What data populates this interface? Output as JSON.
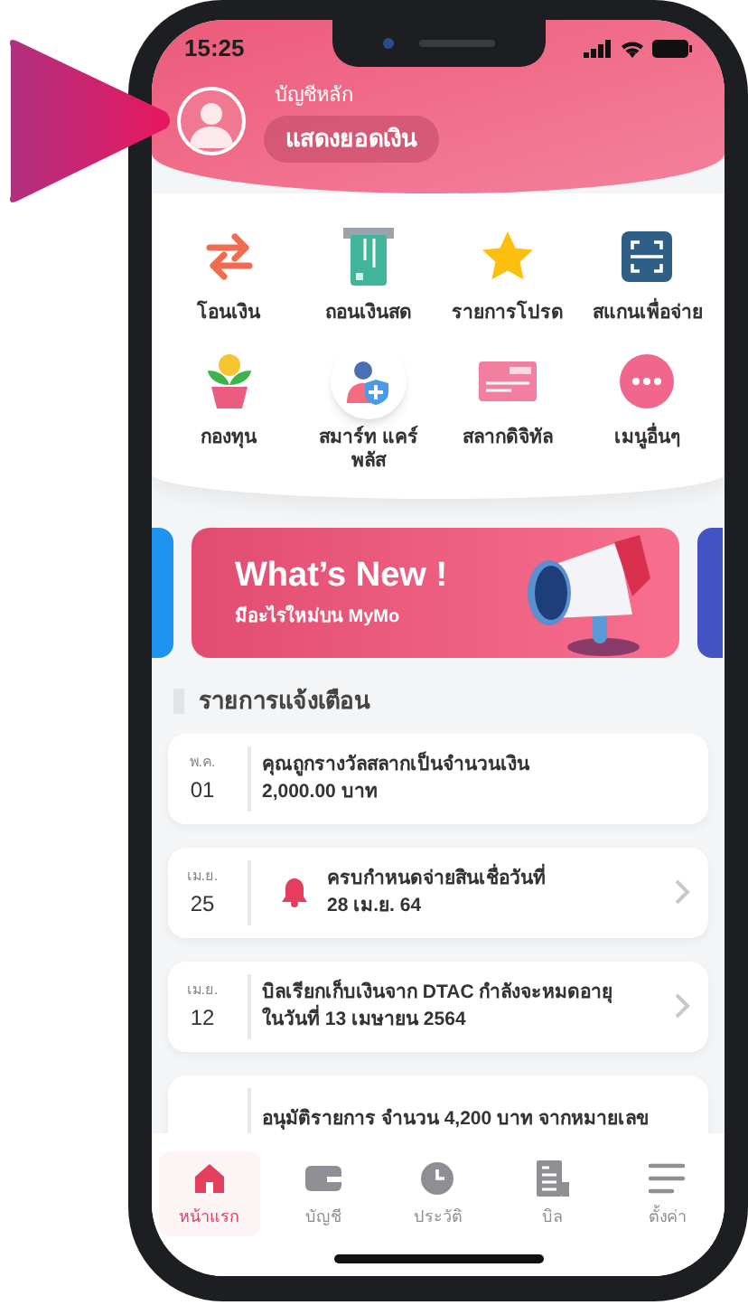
{
  "status_bar": {
    "time": "15:25"
  },
  "header": {
    "account_label": "บัญชีหลัก",
    "balance_button": "แสดงยอดเงิน"
  },
  "menu": [
    {
      "kind": "transfer",
      "label": "โอนเงิน"
    },
    {
      "kind": "atm",
      "label": "ถอนเงินสด"
    },
    {
      "kind": "star",
      "label": "รายการโปรด"
    },
    {
      "kind": "scan",
      "label": "สแกนเพื่อจ่าย"
    },
    {
      "kind": "fund",
      "label": "กองทุน"
    },
    {
      "kind": "insurance",
      "label": "สมาร์ท แคร์ พลัส"
    },
    {
      "kind": "lottery",
      "label": "สลากดิจิทัล"
    },
    {
      "kind": "more",
      "label": "เมนูอื่นๆ"
    }
  ],
  "banner": {
    "title": "What’s New !",
    "subtitle": "มีอะไรใหม่บน MyMo"
  },
  "notifications_title": "รายการแจ้งเตือน",
  "notifications": [
    {
      "month": "พ.ค.",
      "day": "01",
      "lines": [
        "คุณถูกรางวัลสลากเป็นจำนวนเงิน",
        "2,000.00 บาท"
      ],
      "bell": false,
      "chevron": false
    },
    {
      "month": "เม.ย.",
      "day": "25",
      "lines": [
        "ครบกำหนดจ่ายสินเชื่อวันที่",
        "28 เม.ย. 64"
      ],
      "bell": true,
      "chevron": true
    },
    {
      "month": "เม.ย.",
      "day": "12",
      "lines": [
        "บิลเรียกเก็บเงินจาก DTAC กำลังจะหมดอายุ",
        "ในวันที่ 13 เมษายน 2564"
      ],
      "bell": false,
      "chevron": true
    },
    {
      "lines": [
        "อนุมัติรายการ จำนวน 4,200 บาท จากหมายเลข"
      ],
      "bell": false,
      "chevron": false
    }
  ],
  "tabs": [
    {
      "kind": "home",
      "label": "หน้าแรก",
      "selected": true
    },
    {
      "kind": "wallet",
      "label": "บัญชี",
      "selected": false
    },
    {
      "kind": "clock",
      "label": "ประวัติ",
      "selected": false
    },
    {
      "kind": "bill",
      "label": "บิล",
      "selected": false
    },
    {
      "kind": "menu",
      "label": "ตั้งค่า",
      "selected": false
    }
  ]
}
